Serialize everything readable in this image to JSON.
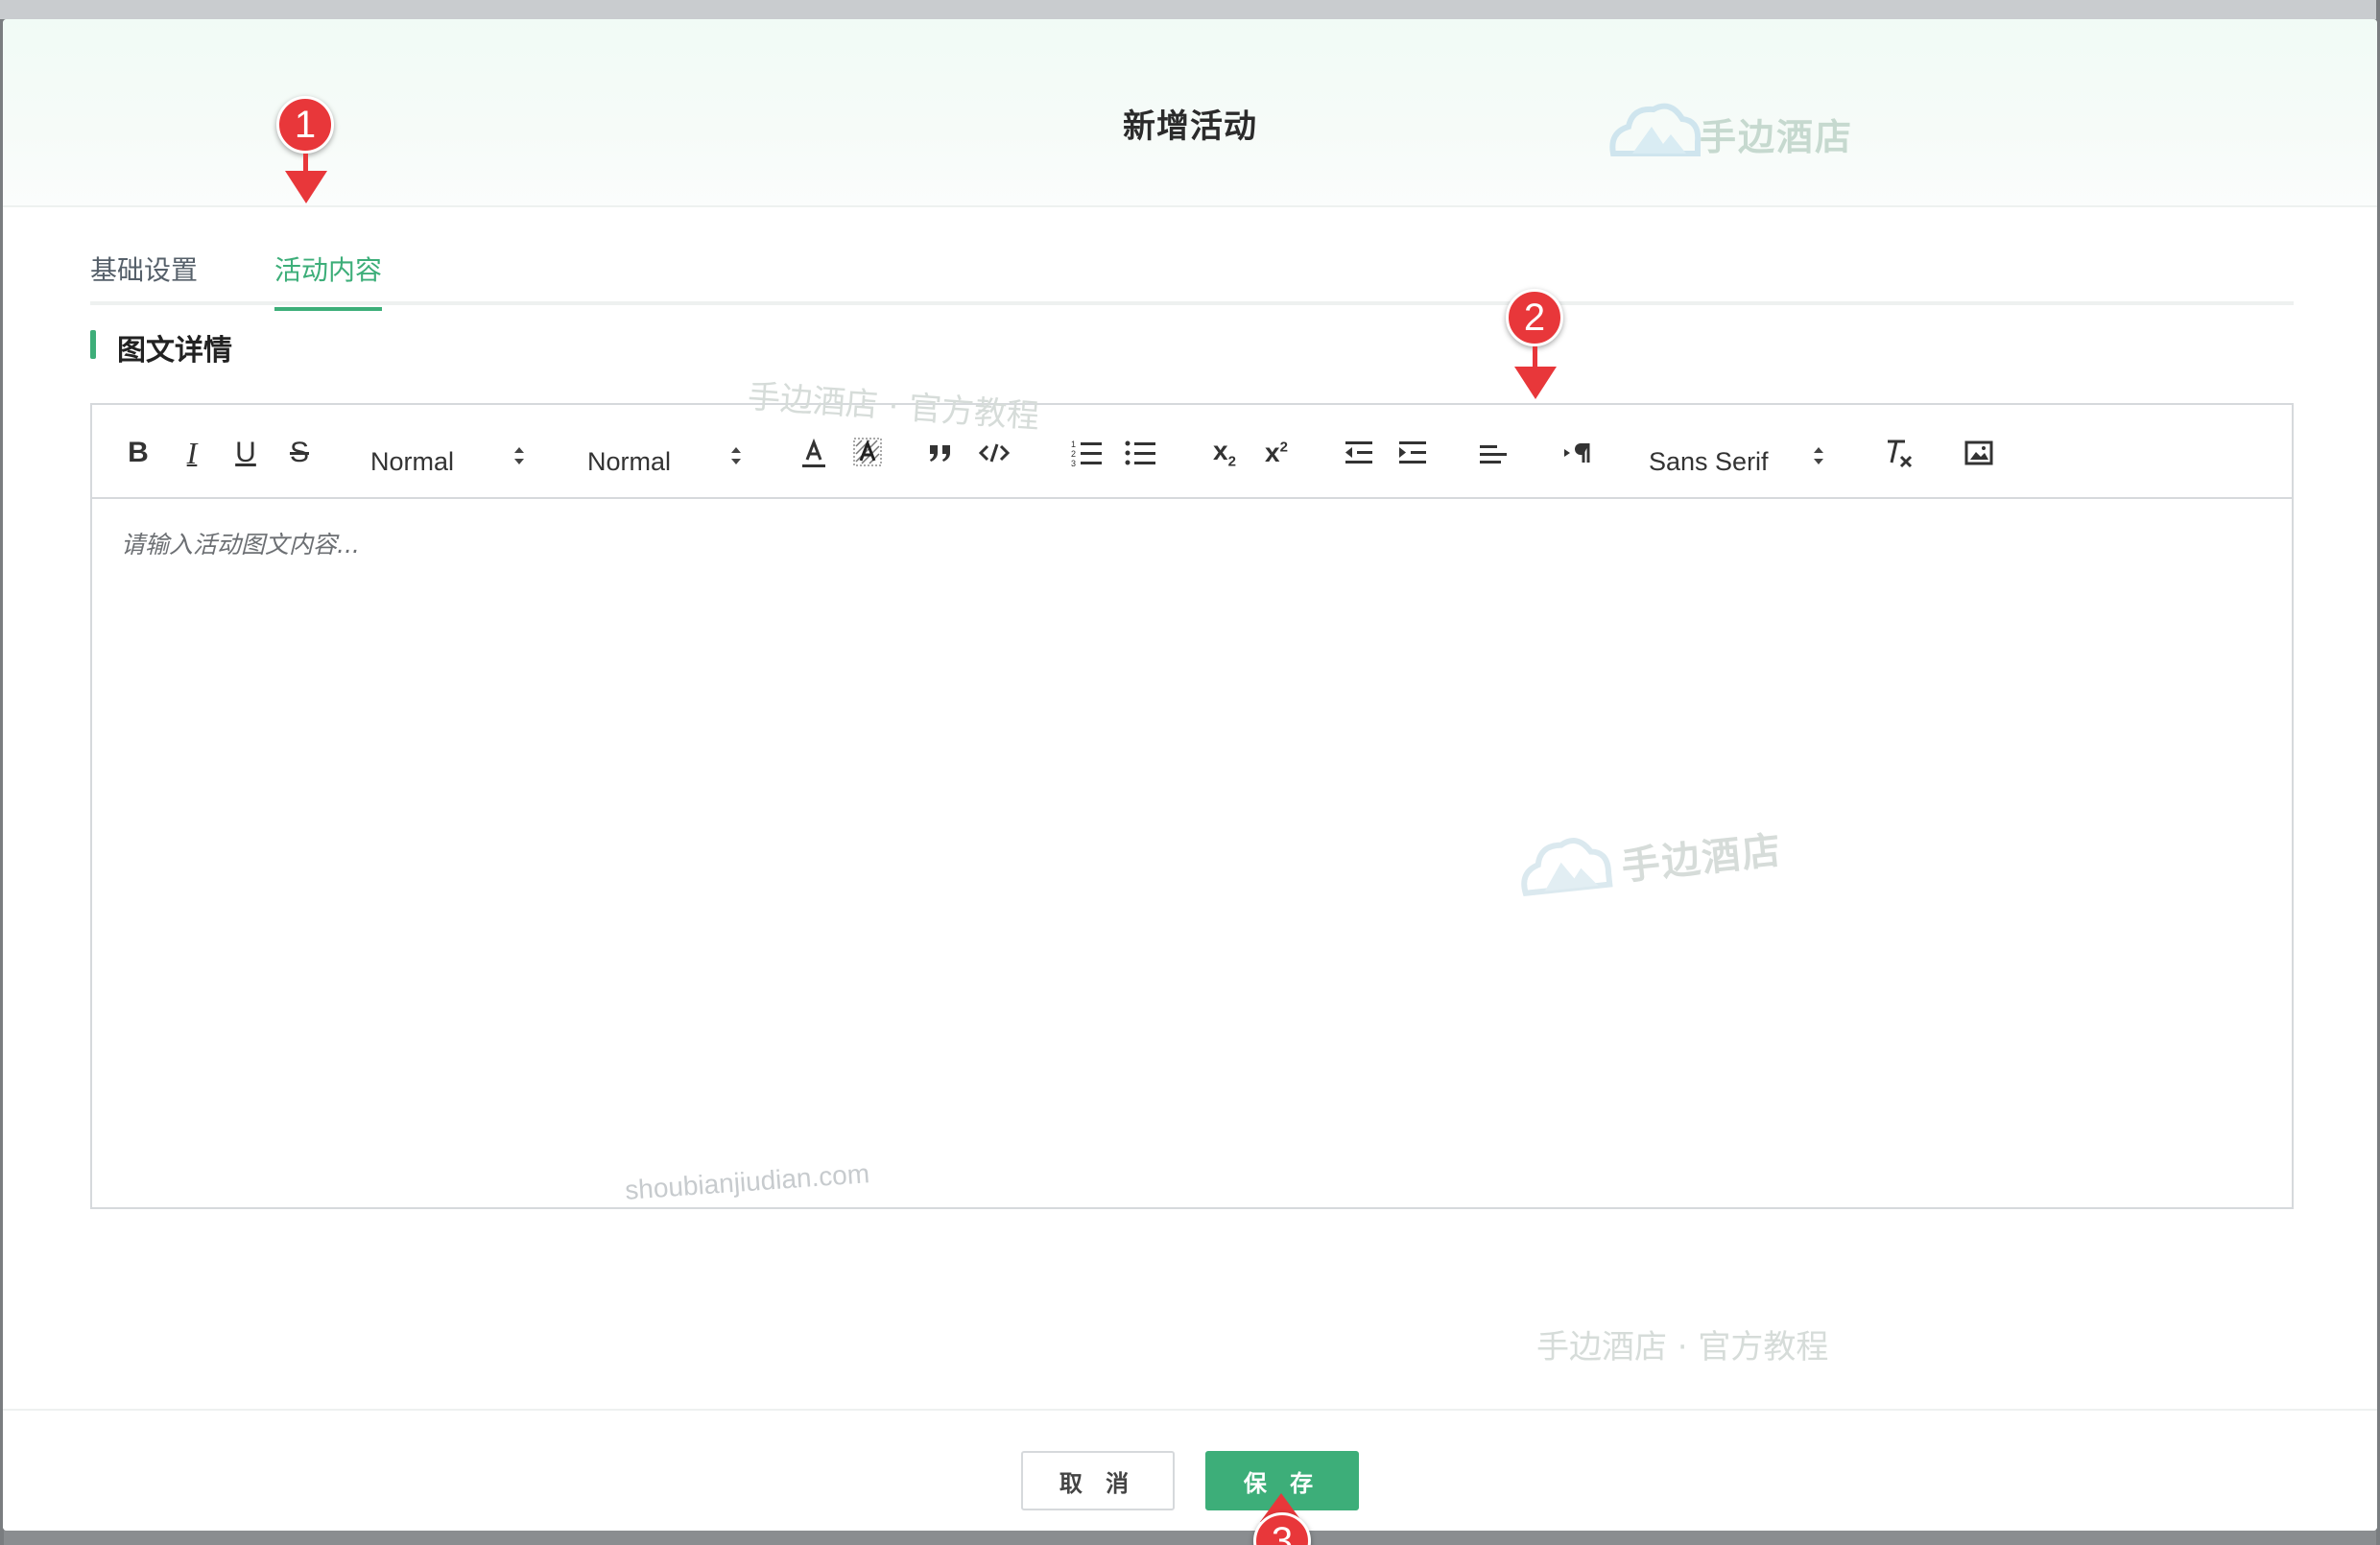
{
  "modal": {
    "title": "新增活动",
    "logo_text": "手边酒店"
  },
  "tabs": [
    {
      "label": "基础设置",
      "active": false
    },
    {
      "label": "活动内容",
      "active": true
    }
  ],
  "section": {
    "title": "图文详情"
  },
  "editor": {
    "toolbar": {
      "bold": "B",
      "italic": "I",
      "underline": "U",
      "strike": "S",
      "header_select": "Normal",
      "size_select": "Normal",
      "subscript_base": "x",
      "subscript_mark": "2",
      "superscript_base": "x",
      "superscript_mark": "2",
      "font_select": "Sans Serif"
    },
    "placeholder": "请输入活动图文内容..."
  },
  "watermarks": {
    "top": "手边酒店 · 官方教程",
    "middle_logo": "手边酒店",
    "url": "shoubianjiudian.com",
    "bottom": "手边酒店 · 官方教程"
  },
  "footer": {
    "cancel_label": "取 消",
    "save_label": "保 存"
  },
  "markers": {
    "one": "1",
    "two": "2",
    "three": "3"
  },
  "colors": {
    "accent": "#3dae79",
    "marker": "#e8373a"
  }
}
